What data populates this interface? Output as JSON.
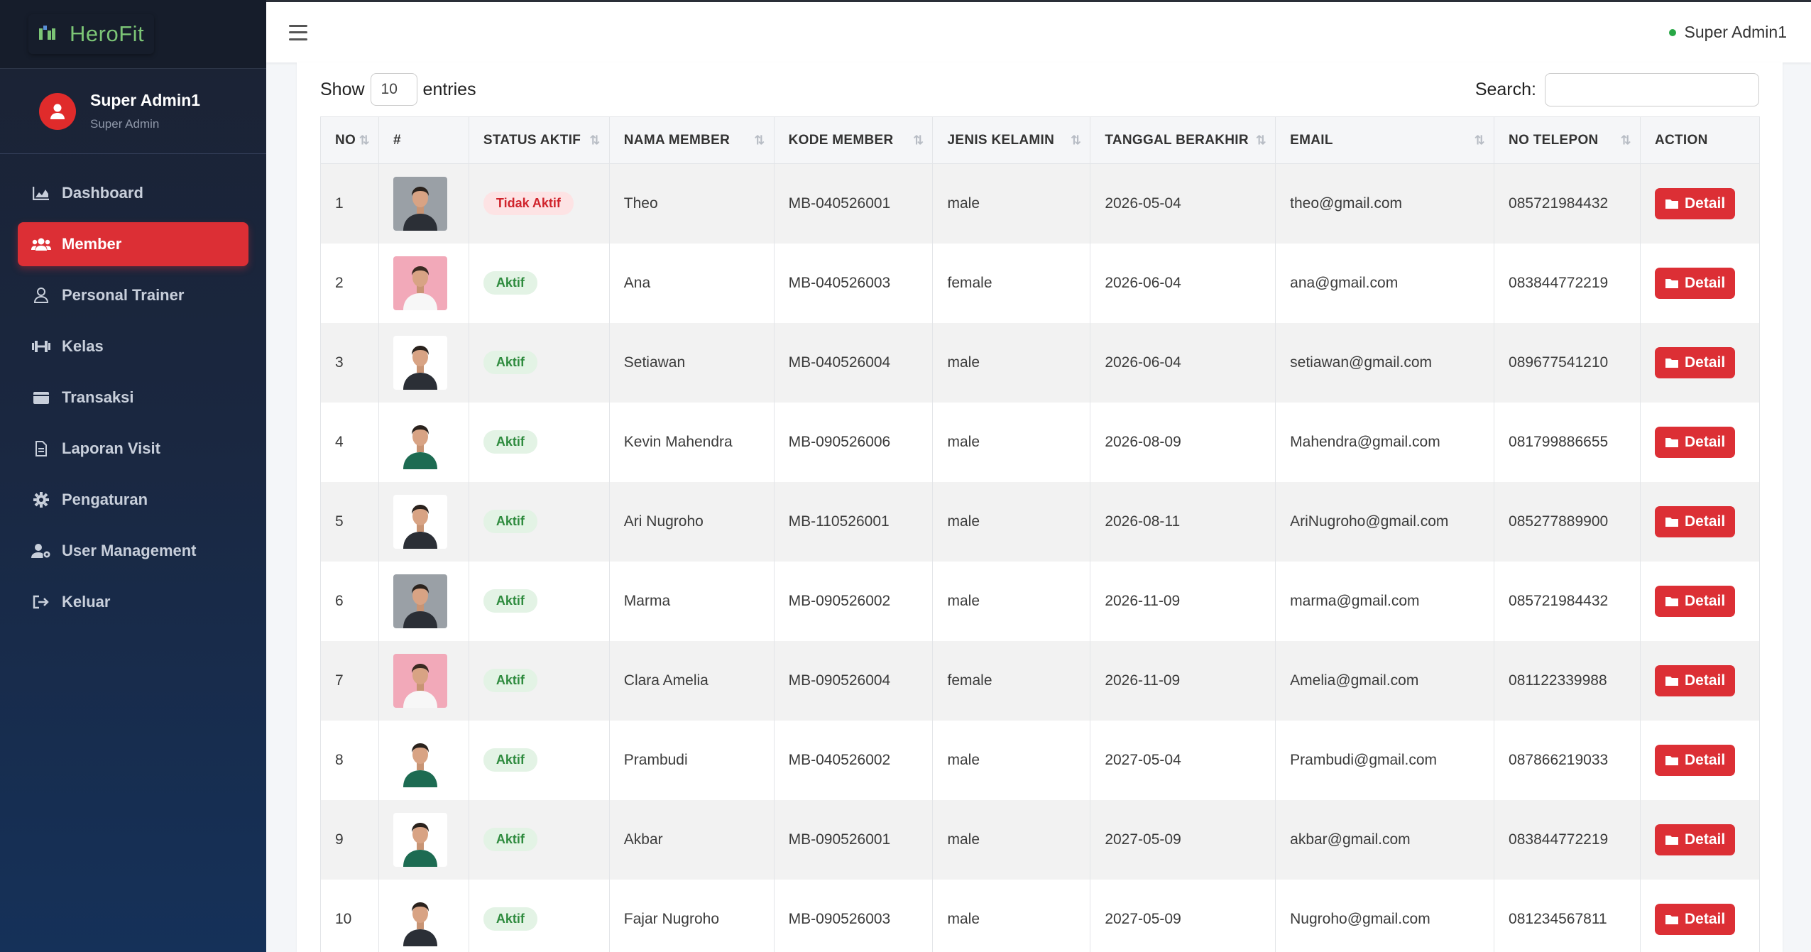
{
  "app": {
    "brand": "HeroFit"
  },
  "user": {
    "name": "Super Admin1",
    "role": "Super Admin"
  },
  "sidebar": {
    "items": [
      {
        "label": "Dashboard",
        "icon": "chart-area-icon",
        "active": false
      },
      {
        "label": "Member",
        "icon": "users-icon",
        "active": true
      },
      {
        "label": "Personal Trainer",
        "icon": "user-icon",
        "active": false
      },
      {
        "label": "Kelas",
        "icon": "dumbbell-icon",
        "active": false
      },
      {
        "label": "Transaksi",
        "icon": "wallet-icon",
        "active": false
      },
      {
        "label": "Laporan Visit",
        "icon": "file-icon",
        "active": false
      },
      {
        "label": "Pengaturan",
        "icon": "gear-icon",
        "active": false
      },
      {
        "label": "User Management",
        "icon": "user-gear-icon",
        "active": false
      },
      {
        "label": "Keluar",
        "icon": "logout-icon",
        "active": false
      }
    ]
  },
  "topbar": {
    "user_label": "Super Admin1"
  },
  "table_controls": {
    "show_label": "Show",
    "length_value": "10",
    "entries_label": "entries",
    "search_label": "Search:"
  },
  "table": {
    "headers": [
      "NO",
      "#",
      "STATUS AKTIF",
      "NAMA MEMBER",
      "KODE MEMBER",
      "JENIS KELAMIN",
      "TANGGAL BERAKHIR",
      "EMAIL",
      "NO TELEPON",
      "ACTION"
    ],
    "detail_label": "Detail",
    "rows": [
      {
        "no": "1",
        "status": "Tidak Aktif",
        "nama": "Theo",
        "kode": "MB-040526001",
        "jk": "male",
        "tgl": "2026-05-04",
        "email": "theo@gmail.com",
        "telp": "085721984432",
        "photo": "gray"
      },
      {
        "no": "2",
        "status": "Aktif",
        "nama": "Ana",
        "kode": "MB-040526003",
        "jk": "female",
        "tgl": "2026-06-04",
        "email": "ana@gmail.com",
        "telp": "083844772219",
        "photo": "pink"
      },
      {
        "no": "3",
        "status": "Aktif",
        "nama": "Setiawan",
        "kode": "MB-040526004",
        "jk": "male",
        "tgl": "2026-06-04",
        "email": "setiawan@gmail.com",
        "telp": "089677541210",
        "photo": "white-dark"
      },
      {
        "no": "4",
        "status": "Aktif",
        "nama": "Kevin Mahendra",
        "kode": "MB-090526006",
        "jk": "male",
        "tgl": "2026-08-09",
        "email": "Mahendra@gmail.com",
        "telp": "081799886655",
        "photo": "white-green"
      },
      {
        "no": "5",
        "status": "Aktif",
        "nama": "Ari Nugroho",
        "kode": "MB-110526001",
        "jk": "male",
        "tgl": "2026-08-11",
        "email": "AriNugroho@gmail.com",
        "telp": "085277889900",
        "photo": "white-dark"
      },
      {
        "no": "6",
        "status": "Aktif",
        "nama": "Marma",
        "kode": "MB-090526002",
        "jk": "male",
        "tgl": "2026-11-09",
        "email": "marma@gmail.com",
        "telp": "085721984432",
        "photo": "gray"
      },
      {
        "no": "7",
        "status": "Aktif",
        "nama": "Clara Amelia",
        "kode": "MB-090526004",
        "jk": "female",
        "tgl": "2026-11-09",
        "email": "Amelia@gmail.com",
        "telp": "081122339988",
        "photo": "pink"
      },
      {
        "no": "8",
        "status": "Aktif",
        "nama": "Prambudi",
        "kode": "MB-040526002",
        "jk": "male",
        "tgl": "2027-05-04",
        "email": "Prambudi@gmail.com",
        "telp": "087866219033",
        "photo": "white-green"
      },
      {
        "no": "9",
        "status": "Aktif",
        "nama": "Akbar",
        "kode": "MB-090526001",
        "jk": "male",
        "tgl": "2027-05-09",
        "email": "akbar@gmail.com",
        "telp": "083844772219",
        "photo": "white-green"
      },
      {
        "no": "10",
        "status": "Aktif",
        "nama": "Fajar Nugroho",
        "kode": "MB-090526003",
        "jk": "male",
        "tgl": "2027-05-09",
        "email": "Nugroho@gmail.com",
        "telp": "081234567811",
        "photo": "white-dark"
      }
    ]
  },
  "colors": {
    "accent": "#dc2f35",
    "aktif_bg": "#e3f3e5",
    "aktif_text": "#2e8b3e",
    "inactive_bg": "#fde3e4",
    "inactive_text": "#d0242c",
    "online": "#28a745"
  }
}
